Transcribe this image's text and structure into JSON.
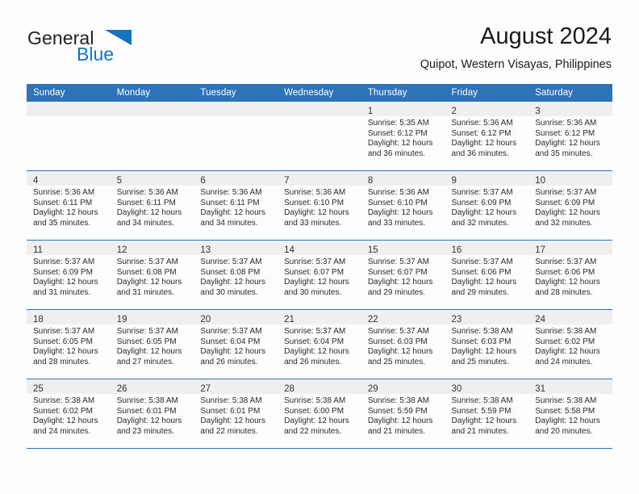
{
  "brand": {
    "name_part1": "General",
    "name_part2": "Blue",
    "logo_icon": "triangle-logo-icon",
    "accent_color": "#1574bb"
  },
  "header": {
    "title": "August 2024",
    "subtitle": "Quipot, Western Visayas, Philippines"
  },
  "theme": {
    "header_blue": "#2e72b7",
    "daynum_band": "#efefef",
    "page_background": "#fdfdfd"
  },
  "calendar": {
    "weekday_headers": [
      "Sunday",
      "Monday",
      "Tuesday",
      "Wednesday",
      "Thursday",
      "Friday",
      "Saturday"
    ],
    "weeks": [
      [
        {
          "day": "",
          "lines": []
        },
        {
          "day": "",
          "lines": []
        },
        {
          "day": "",
          "lines": []
        },
        {
          "day": "",
          "lines": []
        },
        {
          "day": "1",
          "lines": [
            "Sunrise: 5:35 AM",
            "Sunset: 6:12 PM",
            "Daylight: 12 hours",
            "and 36 minutes."
          ]
        },
        {
          "day": "2",
          "lines": [
            "Sunrise: 5:36 AM",
            "Sunset: 6:12 PM",
            "Daylight: 12 hours",
            "and 36 minutes."
          ]
        },
        {
          "day": "3",
          "lines": [
            "Sunrise: 5:36 AM",
            "Sunset: 6:12 PM",
            "Daylight: 12 hours",
            "and 35 minutes."
          ]
        }
      ],
      [
        {
          "day": "4",
          "lines": [
            "Sunrise: 5:36 AM",
            "Sunset: 6:11 PM",
            "Daylight: 12 hours",
            "and 35 minutes."
          ]
        },
        {
          "day": "5",
          "lines": [
            "Sunrise: 5:36 AM",
            "Sunset: 6:11 PM",
            "Daylight: 12 hours",
            "and 34 minutes."
          ]
        },
        {
          "day": "6",
          "lines": [
            "Sunrise: 5:36 AM",
            "Sunset: 6:11 PM",
            "Daylight: 12 hours",
            "and 34 minutes."
          ]
        },
        {
          "day": "7",
          "lines": [
            "Sunrise: 5:36 AM",
            "Sunset: 6:10 PM",
            "Daylight: 12 hours",
            "and 33 minutes."
          ]
        },
        {
          "day": "8",
          "lines": [
            "Sunrise: 5:36 AM",
            "Sunset: 6:10 PM",
            "Daylight: 12 hours",
            "and 33 minutes."
          ]
        },
        {
          "day": "9",
          "lines": [
            "Sunrise: 5:37 AM",
            "Sunset: 6:09 PM",
            "Daylight: 12 hours",
            "and 32 minutes."
          ]
        },
        {
          "day": "10",
          "lines": [
            "Sunrise: 5:37 AM",
            "Sunset: 6:09 PM",
            "Daylight: 12 hours",
            "and 32 minutes."
          ]
        }
      ],
      [
        {
          "day": "11",
          "lines": [
            "Sunrise: 5:37 AM",
            "Sunset: 6:09 PM",
            "Daylight: 12 hours",
            "and 31 minutes."
          ]
        },
        {
          "day": "12",
          "lines": [
            "Sunrise: 5:37 AM",
            "Sunset: 6:08 PM",
            "Daylight: 12 hours",
            "and 31 minutes."
          ]
        },
        {
          "day": "13",
          "lines": [
            "Sunrise: 5:37 AM",
            "Sunset: 6:08 PM",
            "Daylight: 12 hours",
            "and 30 minutes."
          ]
        },
        {
          "day": "14",
          "lines": [
            "Sunrise: 5:37 AM",
            "Sunset: 6:07 PM",
            "Daylight: 12 hours",
            "and 30 minutes."
          ]
        },
        {
          "day": "15",
          "lines": [
            "Sunrise: 5:37 AM",
            "Sunset: 6:07 PM",
            "Daylight: 12 hours",
            "and 29 minutes."
          ]
        },
        {
          "day": "16",
          "lines": [
            "Sunrise: 5:37 AM",
            "Sunset: 6:06 PM",
            "Daylight: 12 hours",
            "and 29 minutes."
          ]
        },
        {
          "day": "17",
          "lines": [
            "Sunrise: 5:37 AM",
            "Sunset: 6:06 PM",
            "Daylight: 12 hours",
            "and 28 minutes."
          ]
        }
      ],
      [
        {
          "day": "18",
          "lines": [
            "Sunrise: 5:37 AM",
            "Sunset: 6:05 PM",
            "Daylight: 12 hours",
            "and 28 minutes."
          ]
        },
        {
          "day": "19",
          "lines": [
            "Sunrise: 5:37 AM",
            "Sunset: 6:05 PM",
            "Daylight: 12 hours",
            "and 27 minutes."
          ]
        },
        {
          "day": "20",
          "lines": [
            "Sunrise: 5:37 AM",
            "Sunset: 6:04 PM",
            "Daylight: 12 hours",
            "and 26 minutes."
          ]
        },
        {
          "day": "21",
          "lines": [
            "Sunrise: 5:37 AM",
            "Sunset: 6:04 PM",
            "Daylight: 12 hours",
            "and 26 minutes."
          ]
        },
        {
          "day": "22",
          "lines": [
            "Sunrise: 5:37 AM",
            "Sunset: 6:03 PM",
            "Daylight: 12 hours",
            "and 25 minutes."
          ]
        },
        {
          "day": "23",
          "lines": [
            "Sunrise: 5:38 AM",
            "Sunset: 6:03 PM",
            "Daylight: 12 hours",
            "and 25 minutes."
          ]
        },
        {
          "day": "24",
          "lines": [
            "Sunrise: 5:38 AM",
            "Sunset: 6:02 PM",
            "Daylight: 12 hours",
            "and 24 minutes."
          ]
        }
      ],
      [
        {
          "day": "25",
          "lines": [
            "Sunrise: 5:38 AM",
            "Sunset: 6:02 PM",
            "Daylight: 12 hours",
            "and 24 minutes."
          ]
        },
        {
          "day": "26",
          "lines": [
            "Sunrise: 5:38 AM",
            "Sunset: 6:01 PM",
            "Daylight: 12 hours",
            "and 23 minutes."
          ]
        },
        {
          "day": "27",
          "lines": [
            "Sunrise: 5:38 AM",
            "Sunset: 6:01 PM",
            "Daylight: 12 hours",
            "and 22 minutes."
          ]
        },
        {
          "day": "28",
          "lines": [
            "Sunrise: 5:38 AM",
            "Sunset: 6:00 PM",
            "Daylight: 12 hours",
            "and 22 minutes."
          ]
        },
        {
          "day": "29",
          "lines": [
            "Sunrise: 5:38 AM",
            "Sunset: 5:59 PM",
            "Daylight: 12 hours",
            "and 21 minutes."
          ]
        },
        {
          "day": "30",
          "lines": [
            "Sunrise: 5:38 AM",
            "Sunset: 5:59 PM",
            "Daylight: 12 hours",
            "and 21 minutes."
          ]
        },
        {
          "day": "31",
          "lines": [
            "Sunrise: 5:38 AM",
            "Sunset: 5:58 PM",
            "Daylight: 12 hours",
            "and 20 minutes."
          ]
        }
      ]
    ]
  }
}
